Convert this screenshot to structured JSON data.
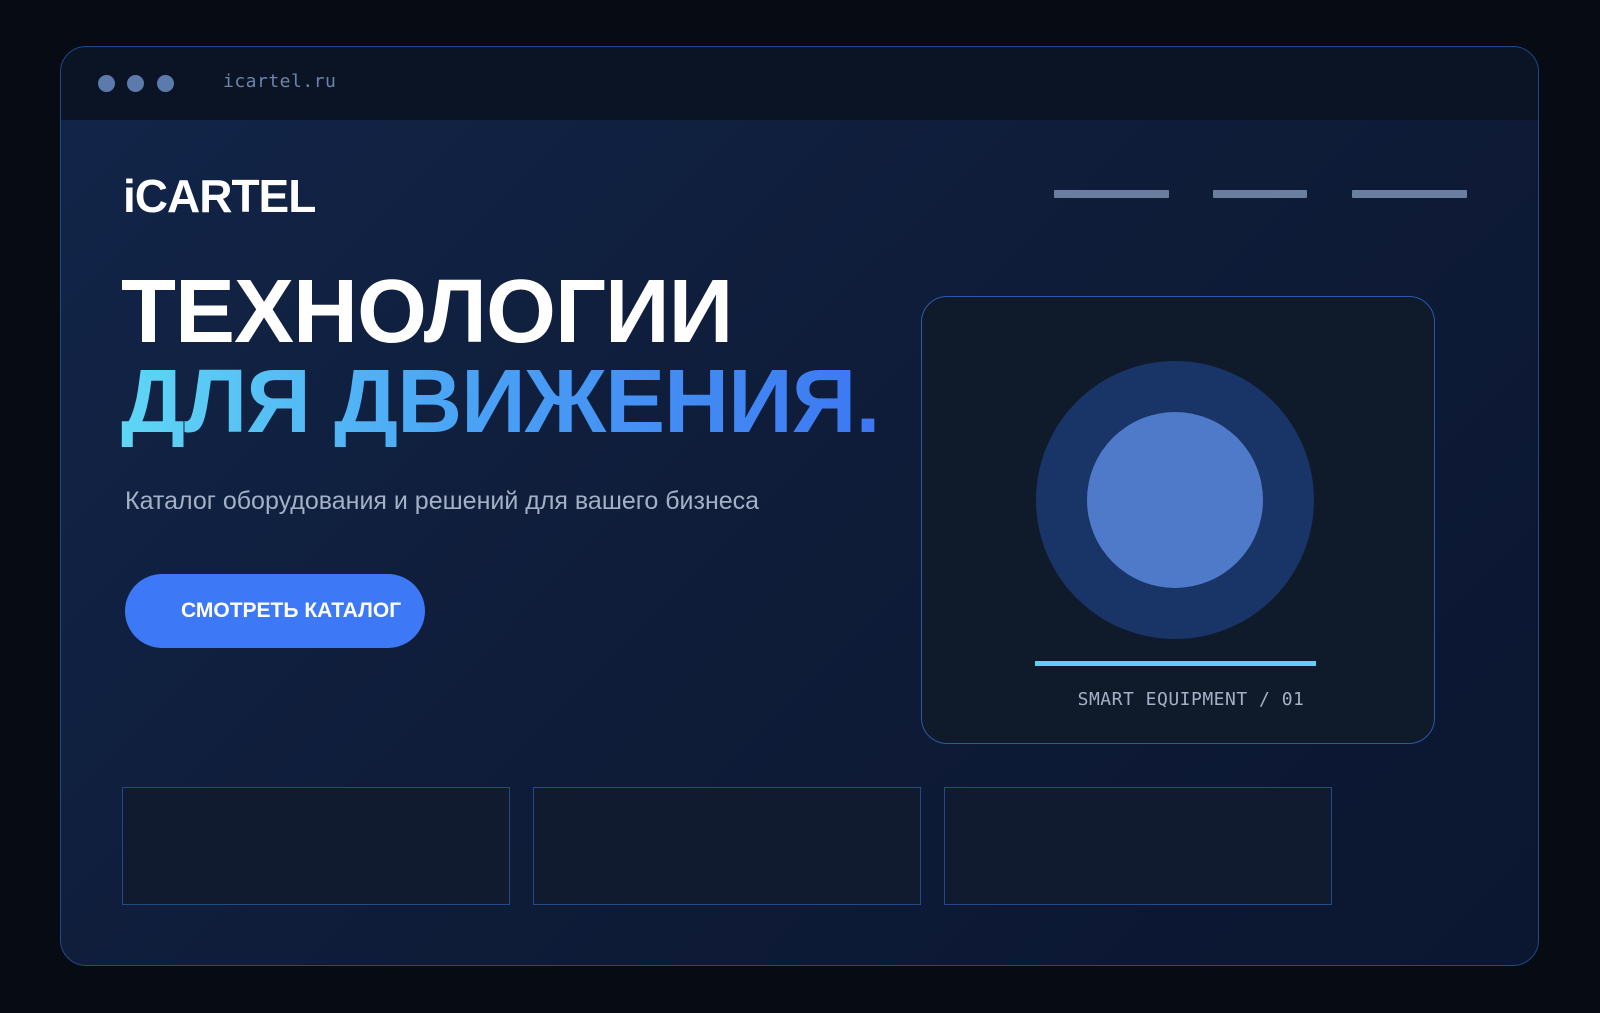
{
  "browser": {
    "url": "icartel.ru"
  },
  "header": {
    "logo": "iCARTEL",
    "nav_items": [
      "",
      "",
      ""
    ]
  },
  "hero": {
    "title_line1": "ТЕХНОЛОГИИ",
    "title_line2": "ДЛЯ ДВИЖЕНИЯ.",
    "subtitle": "Каталог оборудования и решений для вашего бизнеса",
    "cta_label": "СМОТРЕТЬ КАТАЛОГ"
  },
  "product_card": {
    "caption": "SMART EQUIPMENT / 01"
  },
  "colors": {
    "background": "#070b13",
    "window_bg": "#0f1d3a",
    "accent_blue": "#3d78f7",
    "accent_cyan": "#5fd0f5",
    "circle_outer": "#193466",
    "circle_inner": "#4f7ac9",
    "muted_text": "#a3b0c6"
  }
}
